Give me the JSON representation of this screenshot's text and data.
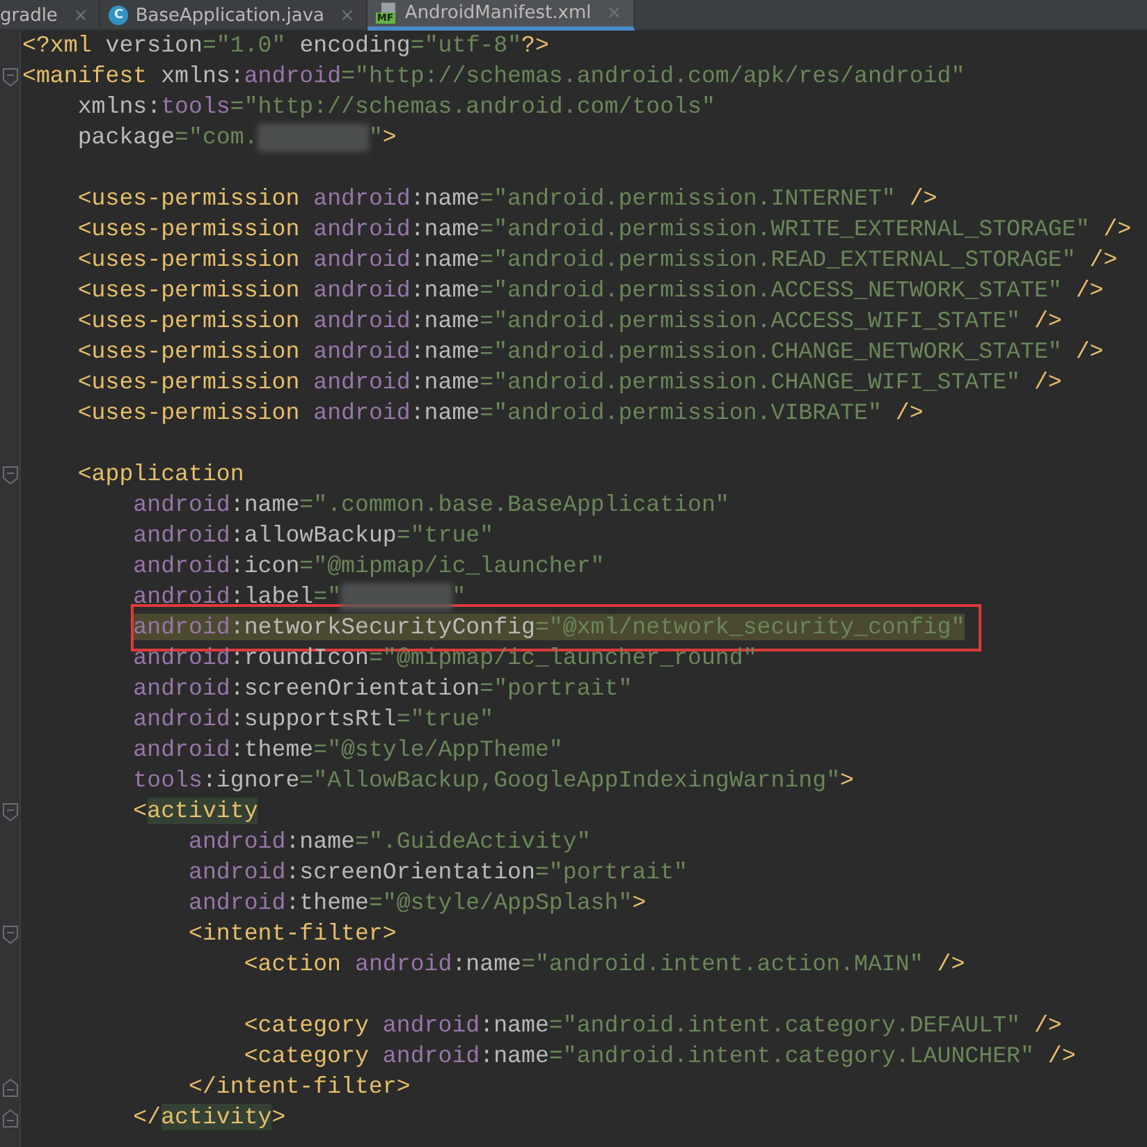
{
  "tabs": [
    {
      "label": "gradle",
      "kind": "plain",
      "selected": false,
      "close": "×"
    },
    {
      "label": "BaseApplication.java",
      "kind": "class",
      "badge": "C",
      "selected": false,
      "close": "×"
    },
    {
      "label": "AndroidManifest.xml",
      "kind": "manifest",
      "badge": "MF",
      "selected": true,
      "close": "×"
    }
  ],
  "editor": {
    "lines": [
      {
        "tokens": [
          {
            "kind": "tag",
            "text": "<?xml "
          },
          {
            "kind": "attr",
            "text": "version"
          },
          {
            "kind": "value",
            "text": "=\"1.0\" "
          },
          {
            "kind": "attr",
            "text": "encoding"
          },
          {
            "kind": "value",
            "text": "=\"utf-8\""
          },
          {
            "kind": "tag",
            "text": "?>"
          }
        ]
      },
      {
        "kind": "fold-start",
        "tokens": [
          {
            "kind": "tag",
            "text": "<manifest "
          },
          {
            "kind": "attr",
            "text": "xmlns:"
          },
          {
            "kind": "ns",
            "text": "android"
          },
          {
            "kind": "value",
            "text": "=\"http://schemas.android.com/apk/res/android\""
          }
        ],
        "children": [
          {
            "tokens": [
              {
                "kind": "attr",
                "text": "xmlns:"
              },
              {
                "kind": "ns",
                "text": "tools"
              },
              {
                "kind": "value",
                "text": "=\"http://schemas.android.com/tools\""
              }
            ]
          },
          {
            "tokens": [
              {
                "kind": "attr",
                "text": "package"
              },
              {
                "kind": "value",
                "text": "=\"com."
              },
              {
                "kind": "redacted"
              },
              {
                "kind": "value",
                "text": "\""
              },
              {
                "kind": "tag",
                "text": ">"
              }
            ]
          },
          {
            "kind": "blank"
          },
          {
            "tokens": [
              {
                "kind": "tag",
                "text": "<uses-permission "
              },
              {
                "kind": "ns",
                "text": "android"
              },
              {
                "kind": "attr",
                "text": ":name"
              },
              {
                "kind": "value",
                "text": "=\"android.permission.INTERNET\" "
              },
              {
                "kind": "tag",
                "text": "/>"
              }
            ]
          },
          {
            "tokens": [
              {
                "kind": "tag",
                "text": "<uses-permission "
              },
              {
                "kind": "ns",
                "text": "android"
              },
              {
                "kind": "attr",
                "text": ":name"
              },
              {
                "kind": "value",
                "text": "=\"android.permission.WRITE_EXTERNAL_STORAGE\" "
              },
              {
                "kind": "tag",
                "text": "/>"
              }
            ]
          },
          {
            "tokens": [
              {
                "kind": "tag",
                "text": "<uses-permission "
              },
              {
                "kind": "ns",
                "text": "android"
              },
              {
                "kind": "attr",
                "text": ":name"
              },
              {
                "kind": "value",
                "text": "=\"android.permission.READ_EXTERNAL_STORAGE\" "
              },
              {
                "kind": "tag",
                "text": "/>"
              }
            ]
          },
          {
            "tokens": [
              {
                "kind": "tag",
                "text": "<uses-permission "
              },
              {
                "kind": "ns",
                "text": "android"
              },
              {
                "kind": "attr",
                "text": ":name"
              },
              {
                "kind": "value",
                "text": "=\"android.permission.ACCESS_NETWORK_STATE\" "
              },
              {
                "kind": "tag",
                "text": "/>"
              }
            ]
          },
          {
            "tokens": [
              {
                "kind": "tag",
                "text": "<uses-permission "
              },
              {
                "kind": "ns",
                "text": "android"
              },
              {
                "kind": "attr",
                "text": ":name"
              },
              {
                "kind": "value",
                "text": "=\"android.permission.ACCESS_WIFI_STATE\" "
              },
              {
                "kind": "tag",
                "text": "/>"
              }
            ]
          },
          {
            "tokens": [
              {
                "kind": "tag",
                "text": "<uses-permission "
              },
              {
                "kind": "ns",
                "text": "android"
              },
              {
                "kind": "attr",
                "text": ":name"
              },
              {
                "kind": "value",
                "text": "=\"android.permission.CHANGE_NETWORK_STATE\" "
              },
              {
                "kind": "tag",
                "text": "/>"
              }
            ]
          },
          {
            "tokens": [
              {
                "kind": "tag",
                "text": "<uses-permission "
              },
              {
                "kind": "ns",
                "text": "android"
              },
              {
                "kind": "attr",
                "text": ":name"
              },
              {
                "kind": "value",
                "text": "=\"android.permission.CHANGE_WIFI_STATE\" "
              },
              {
                "kind": "tag",
                "text": "/>"
              }
            ]
          },
          {
            "tokens": [
              {
                "kind": "tag",
                "text": "<uses-permission "
              },
              {
                "kind": "ns",
                "text": "android"
              },
              {
                "kind": "attr",
                "text": ":name"
              },
              {
                "kind": "value",
                "text": "=\"android.permission.VIBRATE\" "
              },
              {
                "kind": "tag",
                "text": "/>"
              }
            ]
          },
          {
            "kind": "blank"
          },
          {
            "kind": "fold-start",
            "tokens": [
              {
                "kind": "tag",
                "text": "<application"
              }
            ],
            "children": [
              {
                "tokens": [
                  {
                    "kind": "ns",
                    "text": "android"
                  },
                  {
                    "kind": "attr",
                    "text": ":name"
                  },
                  {
                    "kind": "value",
                    "text": "=\".common.base.BaseApplication\""
                  }
                ]
              },
              {
                "tokens": [
                  {
                    "kind": "ns",
                    "text": "android"
                  },
                  {
                    "kind": "attr",
                    "text": ":allowBackup"
                  },
                  {
                    "kind": "value",
                    "text": "=\"true\""
                  }
                ]
              },
              {
                "tokens": [
                  {
                    "kind": "ns",
                    "text": "android"
                  },
                  {
                    "kind": "attr",
                    "text": ":icon"
                  },
                  {
                    "kind": "value",
                    "text": "=\"@mipmap/ic_launcher\""
                  }
                ]
              },
              {
                "tokens": [
                  {
                    "kind": "ns",
                    "text": "android"
                  },
                  {
                    "kind": "attr",
                    "text": ":label"
                  },
                  {
                    "kind": "value",
                    "text": "=\""
                  },
                  {
                    "kind": "redacted"
                  },
                  {
                    "kind": "value",
                    "text": "\""
                  }
                ]
              },
              {
                "boxed": true,
                "tokens": [
                  {
                    "kind": "ns",
                    "text": "android",
                    "highlighted": true
                  },
                  {
                    "kind": "attr",
                    "text": ":networkSecurityConfig",
                    "highlighted": true
                  },
                  {
                    "kind": "value",
                    "text": "=\"@xml/network_security_config\"",
                    "highlighted": true
                  }
                ]
              },
              {
                "tokens": [
                  {
                    "kind": "ns",
                    "text": "android"
                  },
                  {
                    "kind": "attr",
                    "text": ":roundIcon"
                  },
                  {
                    "kind": "value",
                    "text": "=\"@mipmap/ic_launcher_round\""
                  }
                ]
              },
              {
                "tokens": [
                  {
                    "kind": "ns",
                    "text": "android"
                  },
                  {
                    "kind": "attr",
                    "text": ":screenOrientation"
                  },
                  {
                    "kind": "value",
                    "text": "=\"portrait\""
                  }
                ]
              },
              {
                "tokens": [
                  {
                    "kind": "ns",
                    "text": "android"
                  },
                  {
                    "kind": "attr",
                    "text": ":supportsRtl"
                  },
                  {
                    "kind": "value",
                    "text": "=\"true\""
                  }
                ]
              },
              {
                "tokens": [
                  {
                    "kind": "ns",
                    "text": "android"
                  },
                  {
                    "kind": "attr",
                    "text": ":theme"
                  },
                  {
                    "kind": "value",
                    "text": "=\"@style/AppTheme\""
                  }
                ]
              },
              {
                "tokens": [
                  {
                    "kind": "ns",
                    "text": "tools"
                  },
                  {
                    "kind": "attr",
                    "text": ":ignore"
                  },
                  {
                    "kind": "value",
                    "text": "=\"AllowBackup,GoogleAppIndexingWarning\""
                  },
                  {
                    "kind": "tag",
                    "text": ">"
                  }
                ]
              },
              {
                "kind": "fold-start",
                "tokens": [
                  {
                    "kind": "tag",
                    "text": "<"
                  },
                  {
                    "kind": "tag",
                    "text": "activity",
                    "highlighted": true
                  }
                ],
                "children": [
                  {
                    "tokens": [
                      {
                        "kind": "ns",
                        "text": "android"
                      },
                      {
                        "kind": "attr",
                        "text": ":name"
                      },
                      {
                        "kind": "value",
                        "text": "=\".GuideActivity\""
                      }
                    ]
                  },
                  {
                    "tokens": [
                      {
                        "kind": "ns",
                        "text": "android"
                      },
                      {
                        "kind": "attr",
                        "text": ":screenOrientation"
                      },
                      {
                        "kind": "value",
                        "text": "=\"portrait\""
                      }
                    ]
                  },
                  {
                    "tokens": [
                      {
                        "kind": "ns",
                        "text": "android"
                      },
                      {
                        "kind": "attr",
                        "text": ":theme"
                      },
                      {
                        "kind": "value",
                        "text": "=\"@style/AppSplash\""
                      },
                      {
                        "kind": "tag",
                        "text": ">"
                      }
                    ]
                  },
                  {
                    "kind": "fold-start",
                    "tokens": [
                      {
                        "kind": "tag",
                        "text": "<intent-filter>"
                      }
                    ],
                    "children": [
                      {
                        "tokens": [
                          {
                            "kind": "tag",
                            "text": "<action "
                          },
                          {
                            "kind": "ns",
                            "text": "android"
                          },
                          {
                            "kind": "attr",
                            "text": ":name"
                          },
                          {
                            "kind": "value",
                            "text": "=\"android.intent.action.MAIN\" "
                          },
                          {
                            "kind": "tag",
                            "text": "/>"
                          }
                        ]
                      },
                      {
                        "kind": "blank"
                      },
                      {
                        "tokens": [
                          {
                            "kind": "tag",
                            "text": "<category "
                          },
                          {
                            "kind": "ns",
                            "text": "android"
                          },
                          {
                            "kind": "attr",
                            "text": ":name"
                          },
                          {
                            "kind": "value",
                            "text": "=\"android.intent.category.DEFAULT\" "
                          },
                          {
                            "kind": "tag",
                            "text": "/>"
                          }
                        ]
                      },
                      {
                        "tokens": [
                          {
                            "kind": "tag",
                            "text": "<category "
                          },
                          {
                            "kind": "ns",
                            "text": "android"
                          },
                          {
                            "kind": "attr",
                            "text": ":name"
                          },
                          {
                            "kind": "value",
                            "text": "=\"android.intent.category.LAUNCHER\" "
                          },
                          {
                            "kind": "tag",
                            "text": "/>"
                          }
                        ]
                      }
                    ]
                  },
                  {
                    "kind": "fold-end",
                    "tokens": [
                      {
                        "kind": "tag",
                        "text": "</intent-filter>"
                      }
                    ]
                  }
                ]
              },
              {
                "kind": "fold-end",
                "tokens": [
                  {
                    "kind": "tag",
                    "text": "</"
                  },
                  {
                    "kind": "tag",
                    "text": "activity",
                    "highlighted": true
                  },
                  {
                    "kind": "tag",
                    "text": ">"
                  }
                ]
              }
            ]
          }
        ]
      }
    ]
  }
}
